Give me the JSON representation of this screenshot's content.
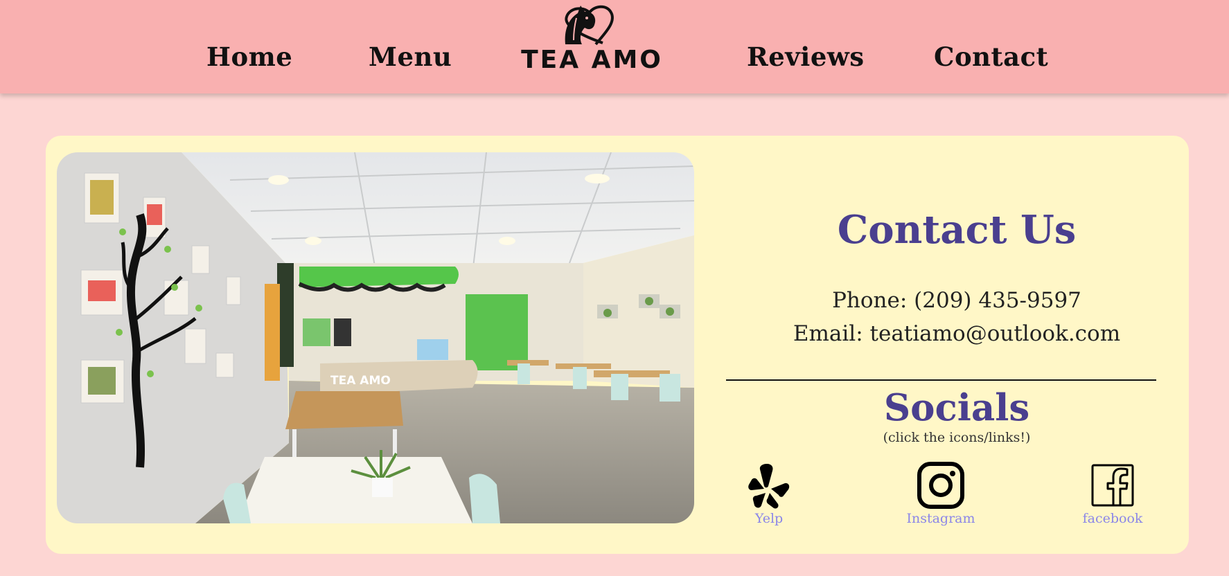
{
  "nav": {
    "home": "Home",
    "menu": "Menu",
    "reviews": "Reviews",
    "contact": "Contact"
  },
  "logo": {
    "text": "TEA AMO"
  },
  "contact": {
    "title": "Contact Us",
    "phone": "Phone: (209) 435-9597",
    "email": "Email: teatiamo@outlook.com"
  },
  "socials": {
    "title": "Socials",
    "hint": "(click the icons/links!)",
    "links": [
      {
        "label": "Yelp",
        "icon": "yelp-icon"
      },
      {
        "label": "Instagram",
        "icon": "instagram-icon"
      },
      {
        "label": "facebook",
        "icon": "facebook-icon"
      }
    ]
  },
  "colors": {
    "header_bg": "#f9b0b0",
    "page_bg": "#fdd6d3",
    "card_bg": "#fff7c7",
    "heading": "#4a3f8f",
    "link": "#8b86e8"
  }
}
